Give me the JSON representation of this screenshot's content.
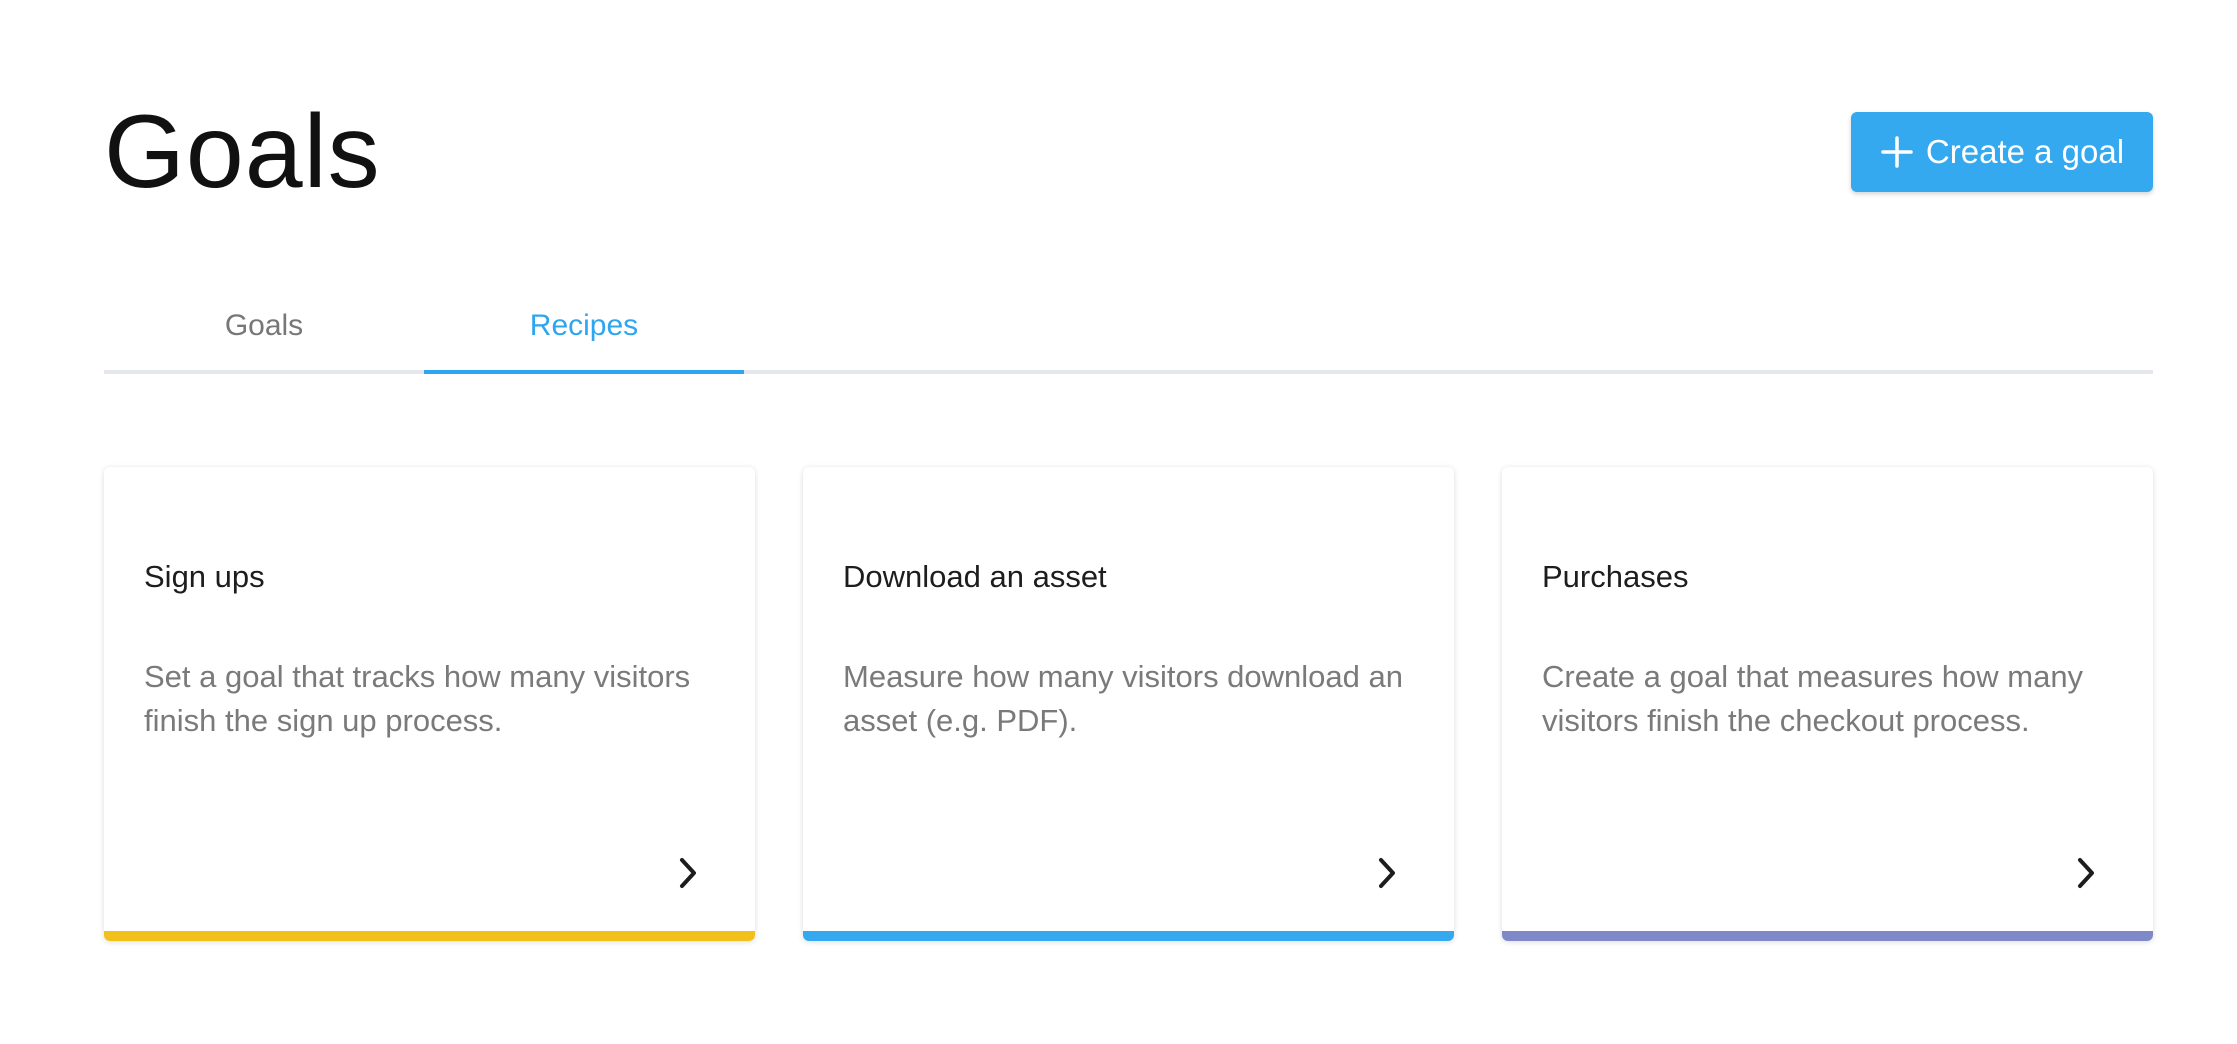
{
  "header": {
    "title": "Goals",
    "create_button_label": "Create a goal",
    "create_button_icon": "plus-icon",
    "accent_color": "#34a9ef"
  },
  "tabs": [
    {
      "label": "Goals",
      "active": false
    },
    {
      "label": "Recipes",
      "active": true
    }
  ],
  "cards": [
    {
      "title": "Sign ups",
      "description": "Set a goal that tracks how many visitors finish the sign up process.",
      "icon": "chevron-right-icon",
      "accent": "#f2c01a"
    },
    {
      "title": "Download an asset",
      "description": "Measure how many visitors download an asset (e.g. PDF).",
      "icon": "chevron-right-icon",
      "accent": "#34a9ef"
    },
    {
      "title": "Purchases",
      "description": "Create a goal that measures how many visitors finish the checkout process.",
      "icon": "chevron-right-icon",
      "accent": "#7f89c8"
    }
  ]
}
